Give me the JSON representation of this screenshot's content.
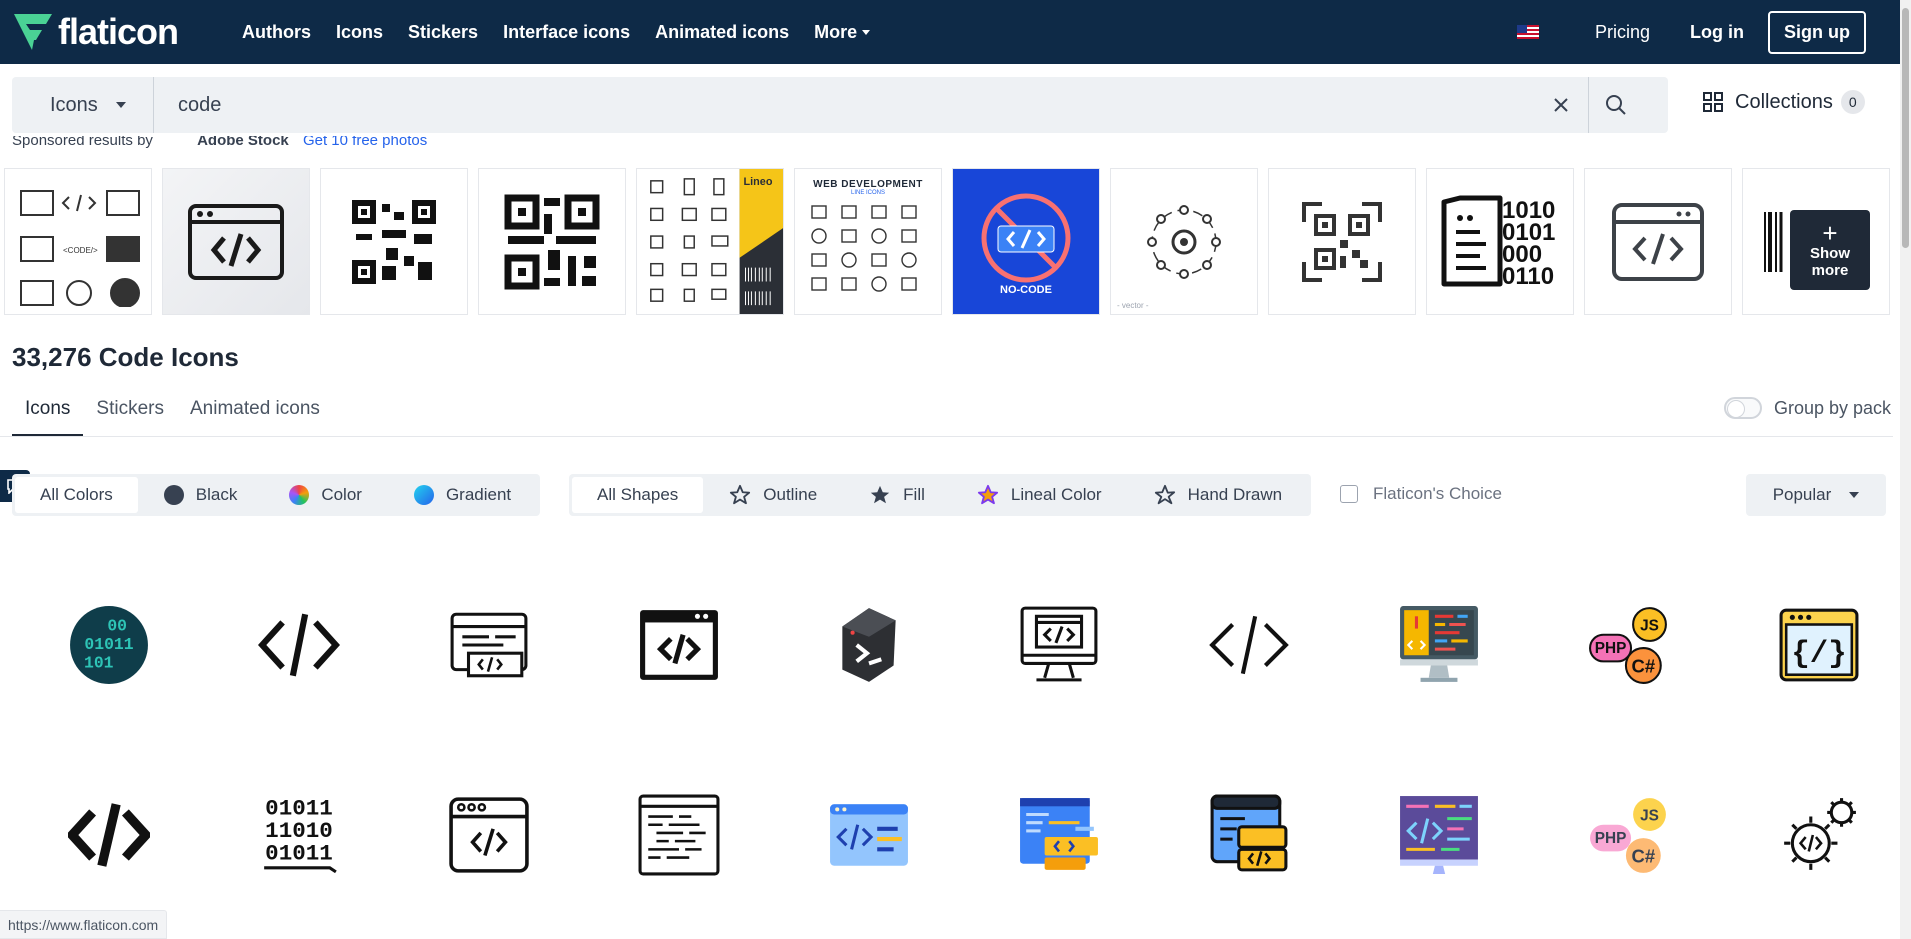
{
  "brand": {
    "name": "flaticon",
    "color": "#0e2a47",
    "accent": "#4ad295"
  },
  "nav": {
    "links": [
      {
        "label": "Authors"
      },
      {
        "label": "Icons"
      },
      {
        "label": "Stickers"
      },
      {
        "label": "Interface icons"
      },
      {
        "label": "Animated icons"
      }
    ],
    "more_label": "More",
    "pricing": "Pricing",
    "login": "Log in",
    "signup": "Sign up"
  },
  "search": {
    "type": "Icons",
    "query": "code",
    "collections_label": "Collections",
    "collections_count": "0"
  },
  "sponsored": {
    "text": "Sponsored results by",
    "brand": "Adobe Stock",
    "link": "Get 10 free photos",
    "web_dev_title": "WEB DEVELOPMENT",
    "web_dev_sub": "LINE ICONS",
    "lineo": "Lineo",
    "no_code": "NO-CODE",
    "vector": "- vector -",
    "show_more": "Show more"
  },
  "results": {
    "title": "33,276 Code Icons",
    "tabs": [
      {
        "label": "Icons"
      },
      {
        "label": "Stickers"
      },
      {
        "label": "Animated icons"
      }
    ],
    "group_by": "Group by pack"
  },
  "filters": {
    "colors": [
      {
        "label": "All Colors"
      },
      {
        "label": "Black"
      },
      {
        "label": "Color"
      },
      {
        "label": "Gradient"
      }
    ],
    "shapes": [
      {
        "label": "All Shapes"
      },
      {
        "label": "Outline"
      },
      {
        "label": "Fill"
      },
      {
        "label": "Lineal Color"
      },
      {
        "label": "Hand Drawn"
      }
    ],
    "choice": "Flaticon's Choice",
    "sort": "Popular"
  },
  "icons": {
    "binary_r1": "00",
    "binary_r2": "01011",
    "binary_r3": "101",
    "binary_tall_r1": "01011",
    "binary_tall_r2": "11010",
    "binary_tall_r3": "01011",
    "php": "PHP",
    "js": "JS",
    "cs": "C#",
    "braces": "{/}",
    "binary_stock_r1": "1010",
    "binary_stock_r2": "0101",
    "binary_stock_r3": "000",
    "binary_stock_r4": "0110",
    "code_small": "<CODE/>"
  },
  "status_url": "https://www.flaticon.com"
}
